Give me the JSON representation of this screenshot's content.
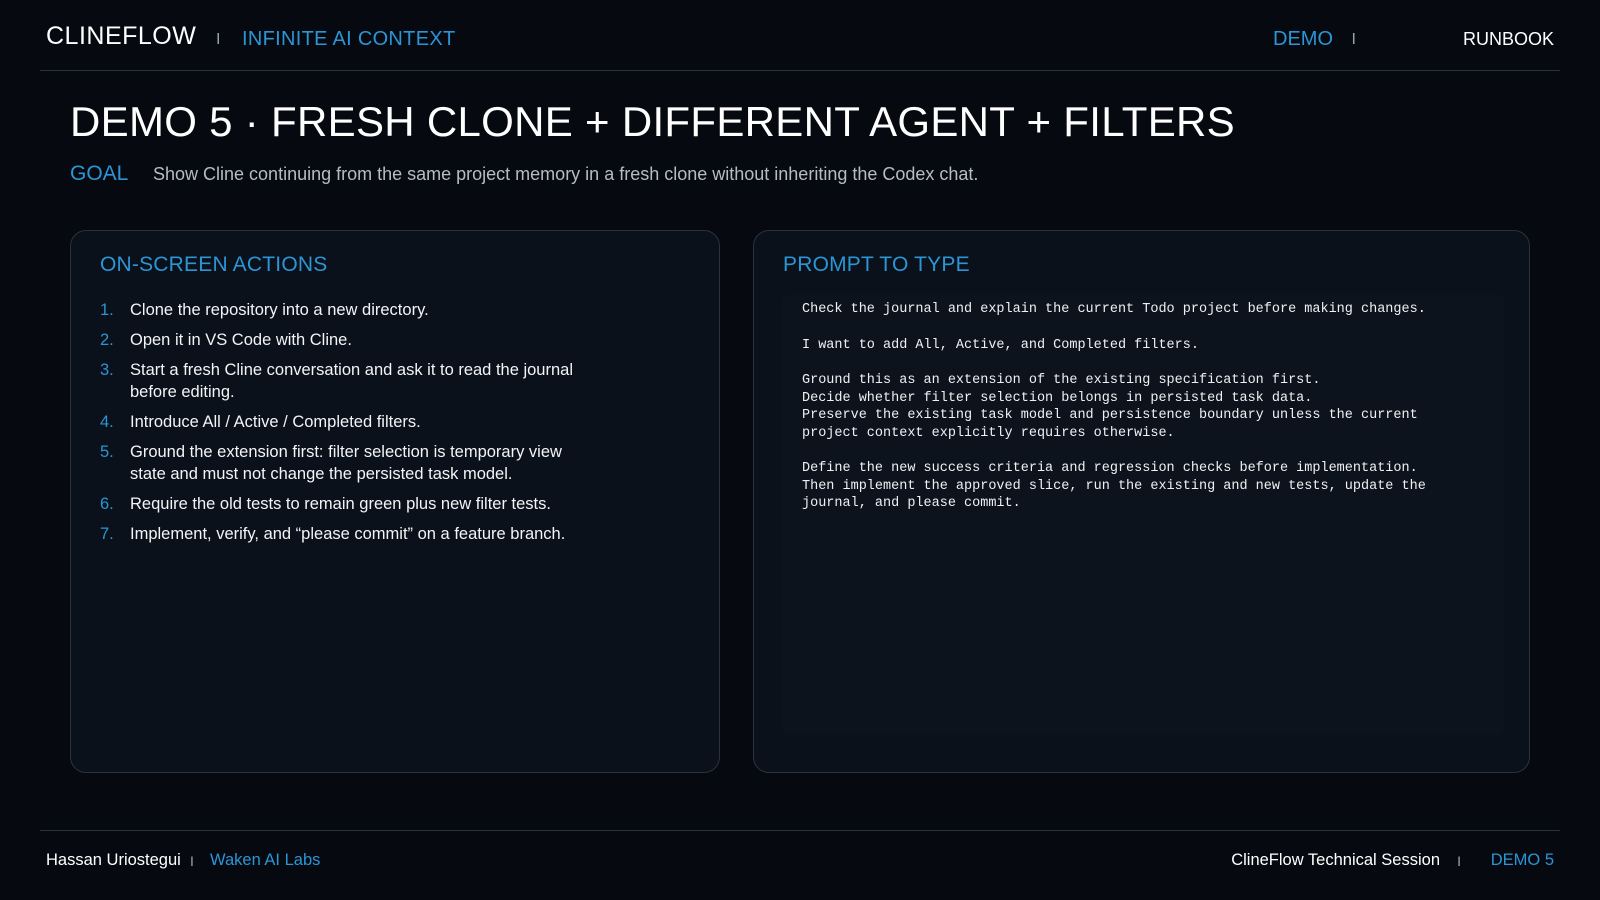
{
  "header": {
    "brand": "CLINEFLOW",
    "separator": "I",
    "tagline": "INFINITE AI CONTEXT",
    "nav_demo": "DEMO",
    "nav_runbook": "RUNBOOK"
  },
  "title": "DEMO 5 · FRESH CLONE + DIFFERENT AGENT + FILTERS",
  "goal": {
    "label": "GOAL",
    "text": "Show Cline continuing from the same project memory in a fresh clone without inheriting the Codex chat."
  },
  "actions": {
    "title": "ON-SCREEN ACTIONS",
    "steps": [
      {
        "num": "1.",
        "text": "Clone the repository into a new directory."
      },
      {
        "num": "2.",
        "text": "Open it in VS Code with Cline."
      },
      {
        "num": "3.",
        "text": "Start a fresh Cline conversation and ask it to read the journal before editing."
      },
      {
        "num": "4.",
        "text": "Introduce All / Active / Completed filters."
      },
      {
        "num": "5.",
        "text": "Ground the extension first: filter selection is temporary view state and must not change the persisted task model."
      },
      {
        "num": "6.",
        "text": "Require the old tests to remain green plus new filter tests."
      },
      {
        "num": "7.",
        "text": "Implement, verify, and “please commit” on a feature branch."
      }
    ]
  },
  "prompt": {
    "title": "PROMPT TO TYPE",
    "lines": [
      "Check the journal and explain the current Todo project before making changes.",
      "",
      "I want to add All, Active, and Completed filters.",
      "",
      "Ground this as an extension of the existing specification first.",
      "Decide whether filter selection belongs in persisted task data.",
      "Preserve the existing task model and persistence boundary unless the current",
      "project context explicitly requires otherwise.",
      "",
      "Define the new success criteria and regression checks before implementation.",
      "Then implement the approved slice, run the existing and new tests, update the",
      "journal, and please commit."
    ]
  },
  "footer": {
    "name": "Hassan Uriostegui",
    "separator": "I",
    "org": "Waken AI Labs",
    "session": "ClineFlow Technical Session",
    "demo": "DEMO 5"
  },
  "colors": {
    "background": "#060a10",
    "accent": "#2b95d6",
    "panel": "#0b111a",
    "border": "#2a323d"
  }
}
